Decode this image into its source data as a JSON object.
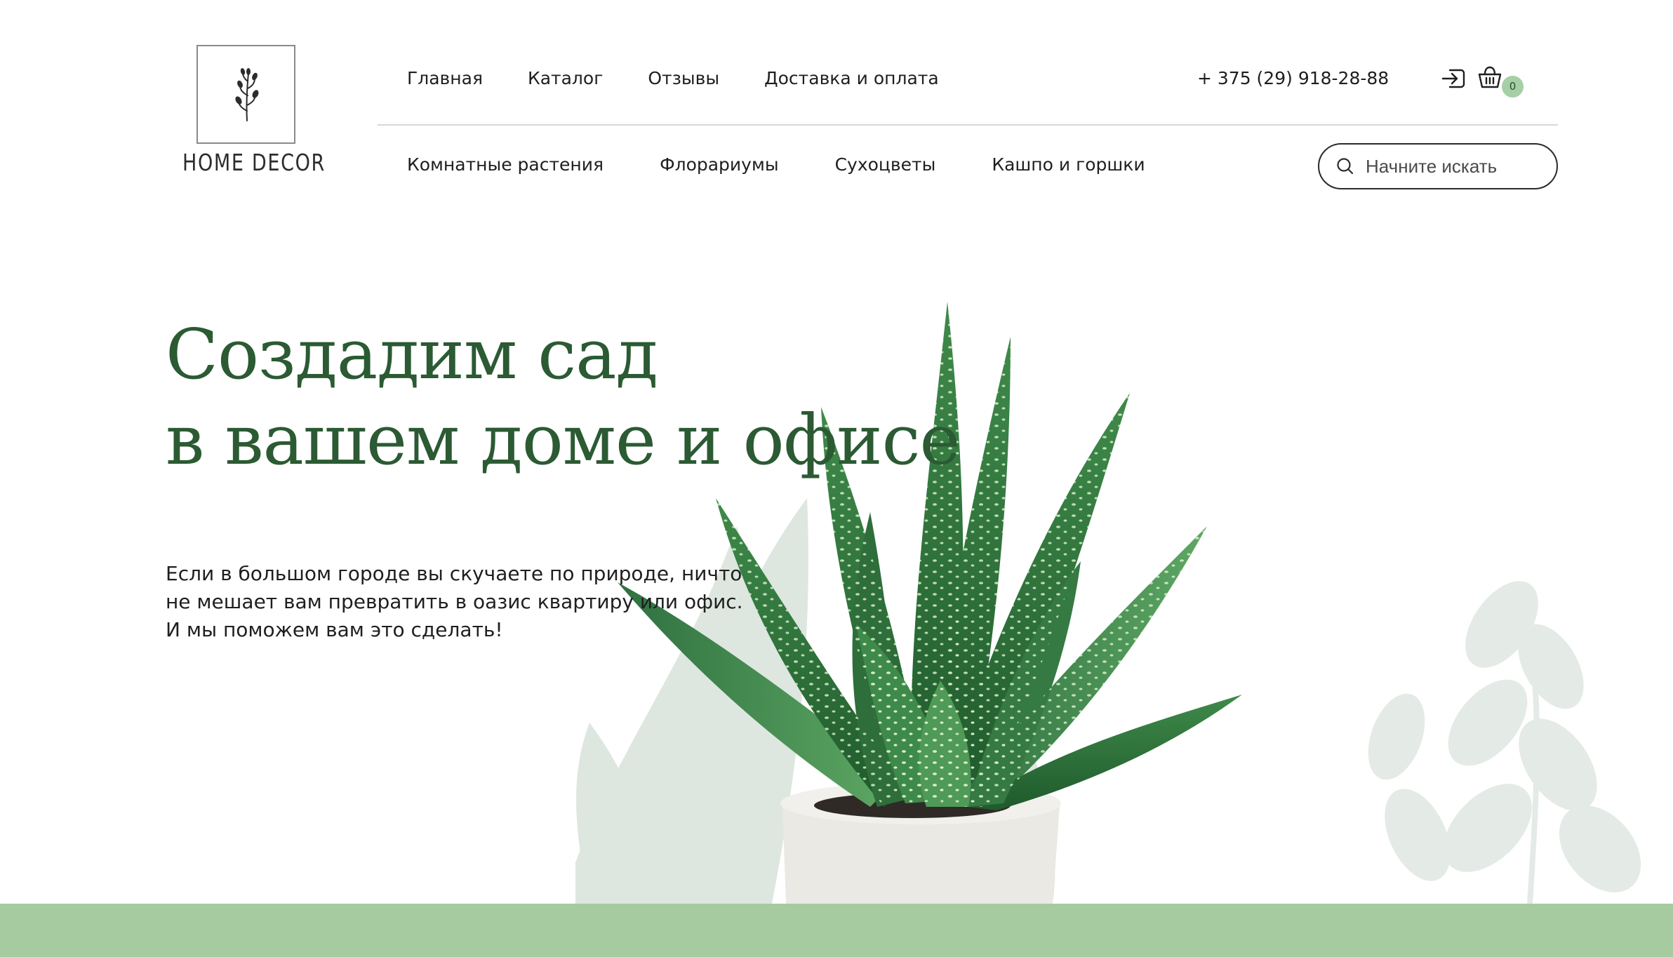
{
  "brand": {
    "logo_text": "HOME DECOR"
  },
  "header": {
    "top_nav": [
      "Главная",
      "Каталог",
      "Отзывы",
      "Доставка и оплата"
    ],
    "phone": "+ 375 (29) 918-28-88",
    "cart_count": "0",
    "categories": [
      "Комнатные растения",
      "Флорариумы",
      "Сухоцветы",
      "Кашпо и горшки"
    ],
    "search_placeholder": "Начните искать"
  },
  "hero": {
    "title_line1": "Создадим сад",
    "title_line2": "в вашем доме и офисе",
    "text_line1": "Если в большом городе вы скучаете по природе, ничто",
    "text_line2": "не мешает вам превратить в оазис квартиру или офис.",
    "text_line3": "И мы поможем вам это сделать!"
  },
  "colors": {
    "accent_green": "#2b5a33",
    "band_green": "#a6cba0",
    "badge_green": "#a7cfa6"
  },
  "icons": [
    "leaf-sprig-icon",
    "login-icon",
    "basket-icon",
    "search-icon"
  ]
}
